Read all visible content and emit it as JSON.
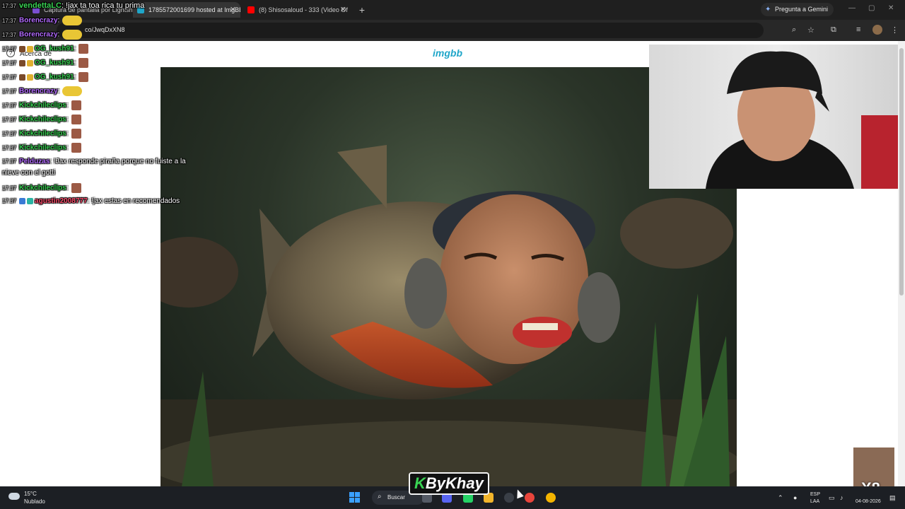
{
  "browser": {
    "tabs": [
      {
        "label": "Captura de pantalla por Lightshot",
        "active": false
      },
      {
        "label": "1785572001699 hosted at ImgBB",
        "active": true
      },
      {
        "label": "(8) Shisosaloud - 333 (Video Of",
        "active": false
      }
    ],
    "new_tab_label": "+",
    "gemini_label": "Pregunta a Gemini",
    "url": "co/JwqDxXN8",
    "colors": {
      "accent": "#1fa6c9",
      "tabbar": "#1f1f1f"
    }
  },
  "page": {
    "site_logo": "imgbb",
    "help_label": "Acerca de",
    "help_icon": "question-icon"
  },
  "chat": {
    "messages": [
      {
        "time": "17:37",
        "user": "vendettaLC",
        "text": ": !jax ta toa rica tu prima",
        "user_color": "#39d353"
      },
      {
        "time": "17:37",
        "user": "Borencrazy",
        "text": ":",
        "user_color": "#b36bff",
        "emote": "pepe"
      },
      {
        "time": "17:37",
        "user": "Borencrazy",
        "text": ":",
        "user_color": "#b36bff",
        "emote": "pepe"
      },
      {
        "time": "17:37",
        "user": "OG_kush91",
        "text": ":",
        "user_color": "#39d353",
        "emote": "face"
      },
      {
        "time": "17:37",
        "user": "OG_kush91",
        "text": ":",
        "user_color": "#39d353",
        "emote": "face"
      },
      {
        "time": "17:37",
        "user": "OG_kush91",
        "text": ":",
        "user_color": "#39d353",
        "emote": "face"
      },
      {
        "time": "17:37",
        "user": "Borencrazy",
        "text": ":",
        "user_color": "#b36bff",
        "emote": "pepe"
      },
      {
        "time": "17:37",
        "user": "Kickchileclips",
        "text": ":",
        "user_color": "#39d353",
        "emote": "face"
      },
      {
        "time": "17:37",
        "user": "Kickchileclips",
        "text": ":",
        "user_color": "#39d353",
        "emote": "face"
      },
      {
        "time": "17:37",
        "user": "Kickchileclips",
        "text": ":",
        "user_color": "#39d353",
        "emote": "face"
      },
      {
        "time": "17:37",
        "user": "Kickchileclips",
        "text": ":",
        "user_color": "#39d353",
        "emote": "face"
      },
      {
        "time": "17:37",
        "user": "Pelduzas",
        "text": ": !Jax responde piraña porque no fuiste a la",
        "user_color": "#b36bff"
      },
      {
        "time": "",
        "user": "",
        "text": "nieve con el gotti",
        "user_color": "#ffffff"
      },
      {
        "time": "17:37",
        "user": "Kickchileclips",
        "text": ":",
        "user_color": "#39d353",
        "emote": "face"
      },
      {
        "time": "17:37",
        "user": "agustin2008777",
        "text": ": !jax estas en recomendados",
        "user_color": "#ff4d6d"
      }
    ]
  },
  "overlay": {
    "watermark_prefix": "K",
    "watermark_rest": "ByKhay",
    "multiplier": "X8"
  },
  "taskbar": {
    "weather_temp": "15°C",
    "weather_desc": "Nublado",
    "search_label": "Buscar",
    "lang_top": "ESP",
    "lang_bottom": "LAA",
    "date": "04-08-2026"
  }
}
